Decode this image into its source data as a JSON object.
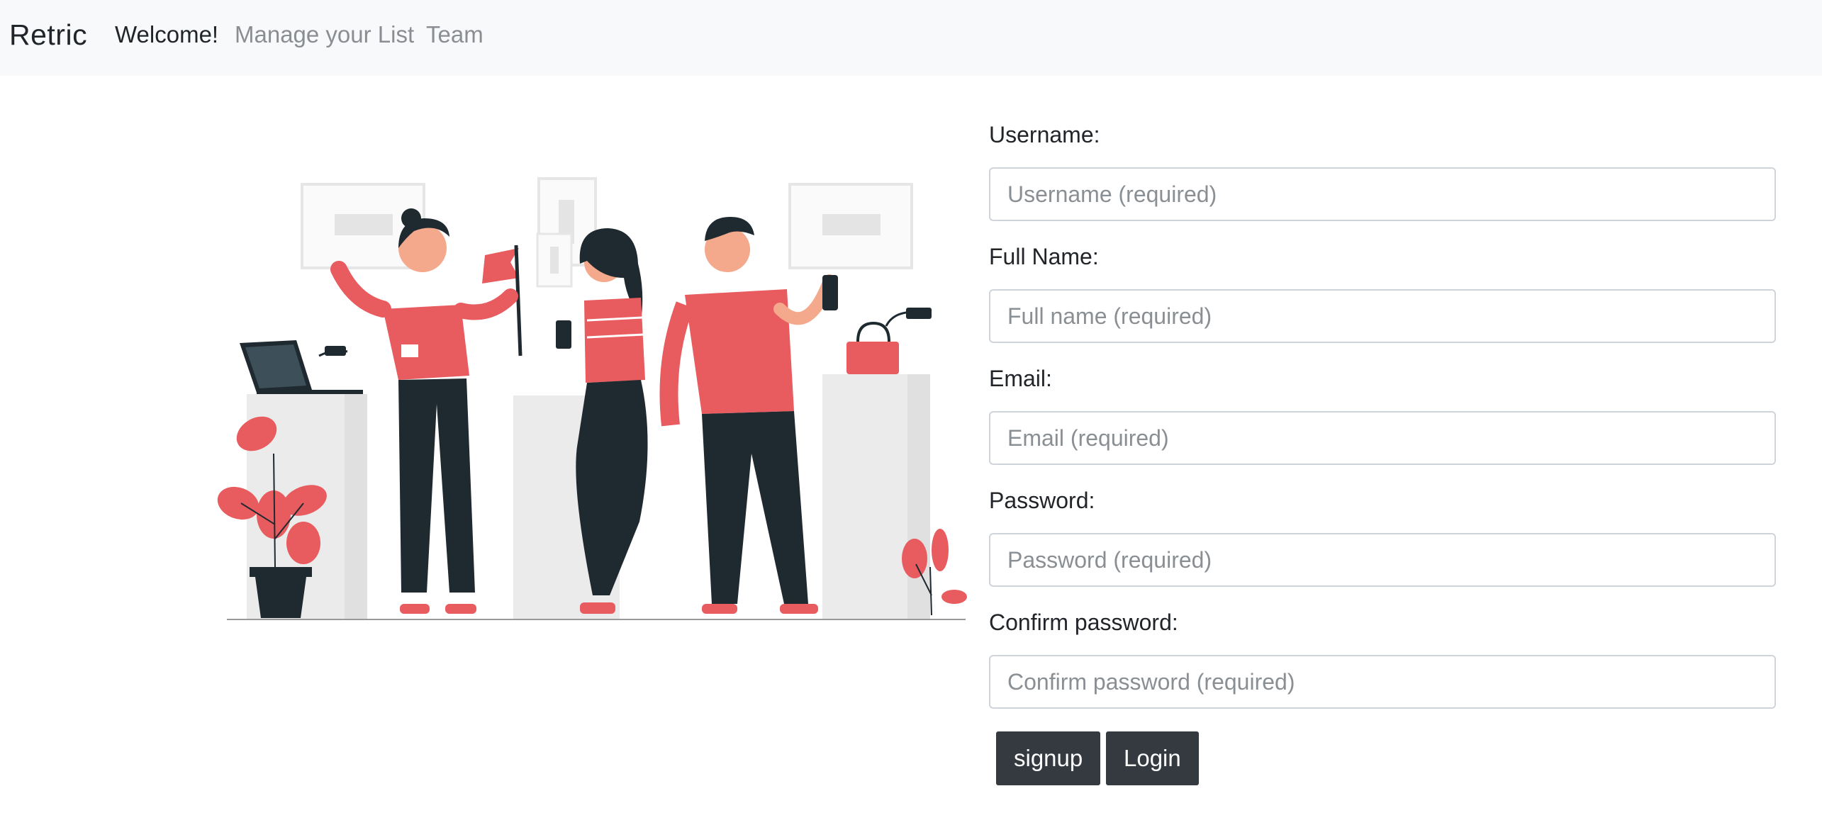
{
  "navbar": {
    "brand": "Retric",
    "links": [
      {
        "label": "Welcome!",
        "active": true
      },
      {
        "label": "Manage your List",
        "active": false
      },
      {
        "label": "Team",
        "active": false
      }
    ]
  },
  "form": {
    "fields": [
      {
        "label": "Username:",
        "placeholder": "Username (required)",
        "value": ""
      },
      {
        "label": "Full Name:",
        "placeholder": "Full name (required)",
        "value": ""
      },
      {
        "label": "Email:",
        "placeholder": "Email (required)",
        "value": ""
      },
      {
        "label": "Password:",
        "placeholder": "Password (required)",
        "value": ""
      },
      {
        "label": "Confirm password:",
        "placeholder": "Confirm password (required)",
        "value": ""
      }
    ],
    "buttons": {
      "signup": "signup",
      "login": "Login"
    }
  },
  "colors": {
    "navbar_bg": "#f8f9fa",
    "button_bg": "#343a40",
    "accent_red": "#e85b5f",
    "dark_navy": "#1f2a30"
  }
}
